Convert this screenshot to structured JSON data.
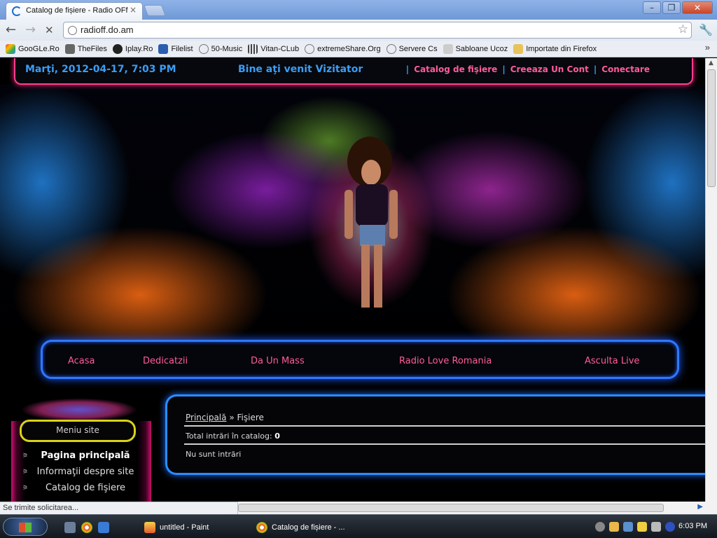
{
  "browser": {
    "tab_title": "Catalog de fișiere - Radio OFf",
    "tab_close": "×",
    "url": "radioff.do.am",
    "window_controls": [
      "–",
      "❐",
      "✕"
    ]
  },
  "bookmarks": [
    {
      "label": "GooGLe.Ro",
      "icon": "google-icon",
      "color": "#4285f4"
    },
    {
      "label": "TheFiles",
      "icon": "thefiles-icon",
      "color": "#555555"
    },
    {
      "label": "Iplay.Ro",
      "icon": "iplay-icon",
      "color": "#333333"
    },
    {
      "label": "Filelist",
      "icon": "filelist-icon",
      "color": "#2a5db0"
    },
    {
      "label": "50-Music",
      "icon": "globe-icon",
      "color": "#888888"
    },
    {
      "label": "Vitan-CLub",
      "icon": "vitan-icon",
      "color": "#666666"
    },
    {
      "label": "extremeShare.Org",
      "icon": "globe-icon",
      "color": "#888888"
    },
    {
      "label": "Servere Cs",
      "icon": "globe-icon",
      "color": "#888888"
    },
    {
      "label": "Sabloane Ucoz",
      "icon": "ucoz-icon",
      "color": "#bbbbbb"
    },
    {
      "label": "Importate din Firefox",
      "icon": "folder-icon",
      "color": "#e8c25a"
    }
  ],
  "bookmarks_more": "»",
  "site": {
    "date": "Marţi, 2012-04-17, 7:03 PM",
    "welcome": "Bine aţi venit Vizitator",
    "top_links": [
      "Catalog de fişiere",
      "Creeaza Un Cont",
      "Conectare"
    ],
    "top_sep": "|",
    "nav": [
      "Acasa",
      "Dedicatzii",
      "Da Un Mass",
      "Radio Love Romania",
      "Asculta Live"
    ],
    "sidebar": {
      "title": "Meniu site",
      "items": [
        "Pagina principală",
        "Informaţii despre site",
        "Catalog de fişiere"
      ]
    },
    "content": {
      "breadcrumb_home": "Principală",
      "breadcrumb_sep": "»",
      "breadcrumb_current": "Fişiere",
      "total_label": "Total intrări în catalog:",
      "total_value": "0",
      "empty_text": "Nu sunt intrări"
    }
  },
  "status": "Se trimite solicitarea...",
  "taskbar": {
    "items": [
      "untitled - Paint",
      "Catalog de fișiere - ..."
    ],
    "clock": "6:03 PM"
  },
  "colors": {
    "accent_blue": "#3a9df5",
    "link_pink": "#ff5b9d",
    "nav_border": "#2f78ff",
    "menu_border": "#d8d21a"
  }
}
